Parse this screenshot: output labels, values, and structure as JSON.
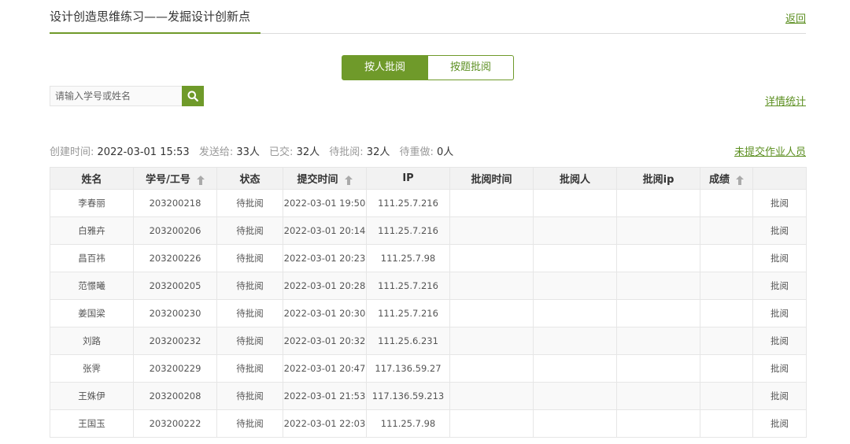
{
  "header": {
    "title": "设计创造思维练习——发掘设计创新点",
    "back_label": "返回"
  },
  "tabs": [
    {
      "label": "按人批阅",
      "active": true
    },
    {
      "label": "按题批阅",
      "active": false
    }
  ],
  "search": {
    "placeholder": "请输入学号或姓名",
    "icon": "search-icon"
  },
  "links": {
    "detail_stats": "详情统计",
    "unsubmitted": "未提交作业人员"
  },
  "stats": {
    "created_label": "创建时间:",
    "created_value": "2022-03-01 15:53",
    "sent_label": "发送给:",
    "sent_value": "33人",
    "submitted_label": "已交:",
    "submitted_value": "32人",
    "pending_label": "待批阅:",
    "pending_value": "32人",
    "redo_label": "待重做:",
    "redo_value": "0人"
  },
  "table": {
    "columns": [
      "姓名",
      "学号/工号",
      "状态",
      "提交时间",
      "IP",
      "批阅时间",
      "批阅人",
      "批阅ip",
      "成绩",
      ""
    ],
    "sortable": [
      "学号/工号",
      "提交时间",
      "成绩"
    ],
    "rows": [
      {
        "name": "李春丽",
        "id": "203200218",
        "status": "待批阅",
        "time": "2022-03-01 19:50",
        "ip": "111.25.7.216",
        "review_time": "",
        "reviewer": "",
        "review_ip": "",
        "score": "",
        "action": "批阅"
      },
      {
        "name": "白雅卉",
        "id": "203200206",
        "status": "待批阅",
        "time": "2022-03-01 20:14",
        "ip": "111.25.7.216",
        "review_time": "",
        "reviewer": "",
        "review_ip": "",
        "score": "",
        "action": "批阅"
      },
      {
        "name": "昌百祎",
        "id": "203200226",
        "status": "待批阅",
        "time": "2022-03-01 20:23",
        "ip": "111.25.7.98",
        "review_time": "",
        "reviewer": "",
        "review_ip": "",
        "score": "",
        "action": "批阅"
      },
      {
        "name": "范憬曦",
        "id": "203200205",
        "status": "待批阅",
        "time": "2022-03-01 20:28",
        "ip": "111.25.7.216",
        "review_time": "",
        "reviewer": "",
        "review_ip": "",
        "score": "",
        "action": "批阅"
      },
      {
        "name": "姜国梁",
        "id": "203200230",
        "status": "待批阅",
        "time": "2022-03-01 20:30",
        "ip": "111.25.7.216",
        "review_time": "",
        "reviewer": "",
        "review_ip": "",
        "score": "",
        "action": "批阅"
      },
      {
        "name": "刘路",
        "id": "203200232",
        "status": "待批阅",
        "time": "2022-03-01 20:32",
        "ip": "111.25.6.231",
        "review_time": "",
        "reviewer": "",
        "review_ip": "",
        "score": "",
        "action": "批阅"
      },
      {
        "name": "张霁",
        "id": "203200229",
        "status": "待批阅",
        "time": "2022-03-01 20:47",
        "ip": "117.136.59.27",
        "review_time": "",
        "reviewer": "",
        "review_ip": "",
        "score": "",
        "action": "批阅"
      },
      {
        "name": "王姝伊",
        "id": "203200208",
        "status": "待批阅",
        "time": "2022-03-01 21:53",
        "ip": "117.136.59.213",
        "review_time": "",
        "reviewer": "",
        "review_ip": "",
        "score": "",
        "action": "批阅"
      },
      {
        "name": "王国玉",
        "id": "203200222",
        "status": "待批阅",
        "time": "2022-03-01 22:03",
        "ip": "111.25.7.98",
        "review_time": "",
        "reviewer": "",
        "review_ip": "",
        "score": "",
        "action": "批阅"
      }
    ]
  },
  "colors": {
    "accent": "#6f9a2a",
    "link": "#5c8f21",
    "status_pending": "#e0202a"
  }
}
